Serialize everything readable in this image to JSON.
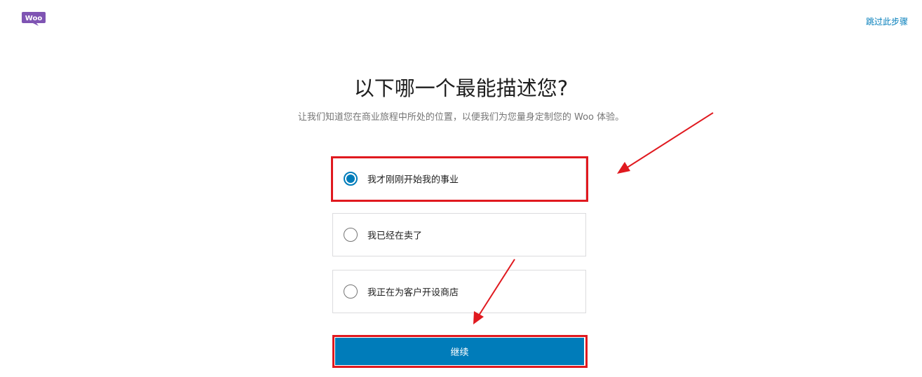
{
  "header": {
    "logo_text": "Woo",
    "skip_label": "跳过此步骤"
  },
  "main": {
    "title": "以下哪一个最能描述您?",
    "subtitle": "让我们知道您在商业旅程中所处的位置，以便我们为您量身定制您的 Woo 体验。",
    "options": [
      {
        "label": "我才刚刚开始我的事业",
        "selected": true
      },
      {
        "label": "我已经在卖了",
        "selected": false
      },
      {
        "label": "我正在为客户开设商店",
        "selected": false
      }
    ],
    "continue_label": "继续"
  },
  "colors": {
    "accent": "#007cba",
    "brand": "#7f54b3",
    "annotation": "#e0191f"
  }
}
